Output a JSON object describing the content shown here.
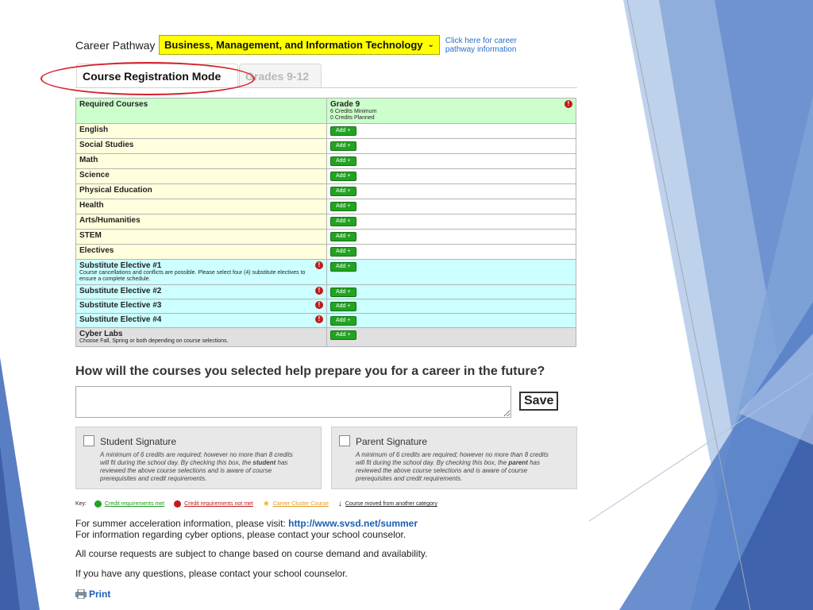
{
  "career_pathway": {
    "label": "Career Pathway",
    "selected": "Business, Management, and Information Technology",
    "link": "Click here for career pathway information"
  },
  "tabs": [
    {
      "label": "Course Registration Mode"
    },
    {
      "label": "Grades 9-12"
    }
  ],
  "table": {
    "header": {
      "label": "Required Courses",
      "grade": "Grade 9",
      "credits_min": "6 Credits Minimum",
      "credits_planned": "0 Credits Planned"
    },
    "add_label": "Add +",
    "required": [
      "English",
      "Social Studies",
      "Math",
      "Science",
      "Physical Education",
      "Health",
      "Arts/Humanities",
      "STEM",
      "Electives"
    ],
    "substitute": [
      {
        "name": "Substitute Elective #1",
        "desc": "Course cancellations and conflicts are possible. Please select four (4) substitute electives to ensure a complete schedule."
      },
      {
        "name": "Substitute Elective #2"
      },
      {
        "name": "Substitute Elective #3"
      },
      {
        "name": "Substitute Elective #4"
      }
    ],
    "cyber": {
      "name": "Cyber Labs",
      "desc": "Choose Fall, Spring or both depending on course selections."
    }
  },
  "question": "How will the courses you selected help prepare you for a career in the future?",
  "save_label": "Save",
  "signatures": {
    "student": {
      "title": "Student Signature",
      "text_a": "A minimum of 6 credits are required; however no more than 8 credits will fit during the school day.  By checking this box, the ",
      "bold": "student",
      "text_b": " has reviewed the above course selections and is aware of course prerequisites and credit requirements."
    },
    "parent": {
      "title": "Parent Signature",
      "text_a": "A minimum of 6 credits are required; however no more than 8 credits will fit during the school day.  By checking this box, the ",
      "bold": "parent",
      "text_b": " has reviewed the above course selections and is aware of course prerequisites and credit requirements."
    }
  },
  "key": {
    "label": "Key:",
    "met": "Credit requirements met",
    "not_met": "Credit requirements not met",
    "cluster": "Career Cluster Course",
    "moved": "Course moved from another category"
  },
  "info": {
    "summer_text": "For summer acceleration information, please visit: ",
    "summer_link": "http://www.svsd.net/summer",
    "cyber_text": "For information regarding cyber options, please contact your school counselor.",
    "change_text": "All course requests are subject to change based on course demand and availability.",
    "questions_text": "If you have any questions, please contact your school counselor.",
    "print_label": "Print"
  },
  "colors": {
    "pathway_yellow": "#ffff00",
    "add_green": "#22a322",
    "error_red": "#c11a1a",
    "link_blue": "#1b5eb5"
  }
}
